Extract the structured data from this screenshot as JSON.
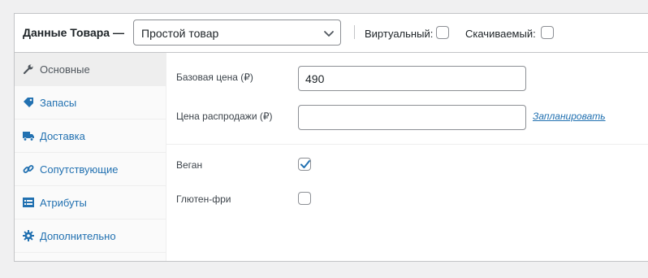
{
  "header": {
    "title": "Данные Товара —",
    "product_type": "Простой товар",
    "virtual_label": "Виртуальный:",
    "virtual_checked": false,
    "downloadable_label": "Скачиваемый:",
    "downloadable_checked": false
  },
  "tabs": [
    {
      "label": "Основные",
      "icon": "wrench-icon",
      "active": true
    },
    {
      "label": "Запасы",
      "icon": "tag-icon",
      "active": false
    },
    {
      "label": "Доставка",
      "icon": "truck-icon",
      "active": false
    },
    {
      "label": "Сопутствующие",
      "icon": "link-icon",
      "active": false
    },
    {
      "label": "Атрибуты",
      "icon": "list-icon",
      "active": false
    },
    {
      "label": "Дополнительно",
      "icon": "gear-icon",
      "active": false
    }
  ],
  "general": {
    "regular_price_label": "Базовая цена (₽)",
    "regular_price_value": "490",
    "sale_price_label": "Цена распродажи (₽)",
    "sale_price_value": "",
    "schedule_link": "Запланировать",
    "vegan_label": "Веган",
    "vegan_checked": true,
    "gluten_free_label": "Глютен-фри",
    "gluten_free_checked": false
  },
  "colors": {
    "accent": "#2271b1",
    "active_tab_bg": "#eeeeee",
    "border": "#c3c4c7"
  }
}
